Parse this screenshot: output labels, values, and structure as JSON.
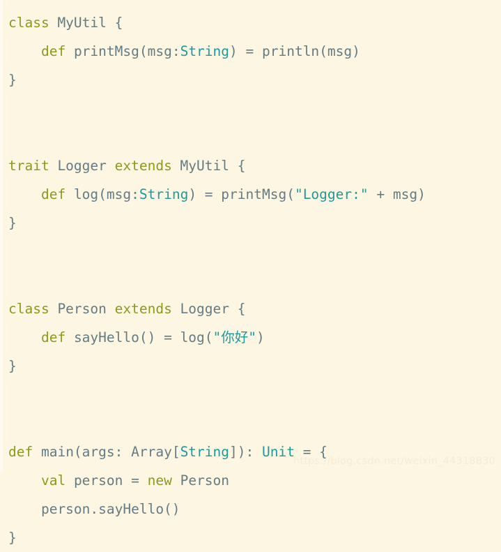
{
  "document": {
    "language": "Scala",
    "background_color": "#fdf6e3",
    "colors": {
      "background": "#fdf6e3",
      "default_text": "#657b83",
      "keyword": "#8a9a1e",
      "type": "#1f9a98",
      "string": "#1f9a98",
      "watermark": "#f6ecd6"
    },
    "watermark": "https://blog.csdn.net/weixin_44318830",
    "lines": [
      {
        "index": 1,
        "tokens": [
          {
            "text": "class",
            "kind": "keyword"
          },
          {
            "text": " MyUtil {",
            "kind": "plain"
          }
        ]
      },
      {
        "index": 2,
        "tokens": [
          {
            "text": "    ",
            "kind": "plain"
          },
          {
            "text": "def",
            "kind": "keyword"
          },
          {
            "text": " printMsg(msg:",
            "kind": "plain"
          },
          {
            "text": "String",
            "kind": "type"
          },
          {
            "text": ") = println(msg)",
            "kind": "plain"
          }
        ]
      },
      {
        "index": 3,
        "tokens": [
          {
            "text": "}",
            "kind": "plain"
          }
        ]
      },
      {
        "index": 4,
        "tokens": []
      },
      {
        "index": 5,
        "tokens": []
      },
      {
        "index": 6,
        "tokens": [
          {
            "text": "trait",
            "kind": "keyword"
          },
          {
            "text": " Logger ",
            "kind": "plain"
          },
          {
            "text": "extends",
            "kind": "keyword"
          },
          {
            "text": " MyUtil {",
            "kind": "plain"
          }
        ]
      },
      {
        "index": 7,
        "tokens": [
          {
            "text": "    ",
            "kind": "plain"
          },
          {
            "text": "def",
            "kind": "keyword"
          },
          {
            "text": " log(msg:",
            "kind": "plain"
          },
          {
            "text": "String",
            "kind": "type"
          },
          {
            "text": ") = printMsg(",
            "kind": "plain"
          },
          {
            "text": "\"Logger:\"",
            "kind": "string"
          },
          {
            "text": " + msg)",
            "kind": "plain"
          }
        ]
      },
      {
        "index": 8,
        "tokens": [
          {
            "text": "}",
            "kind": "plain"
          }
        ]
      },
      {
        "index": 9,
        "tokens": []
      },
      {
        "index": 10,
        "tokens": []
      },
      {
        "index": 11,
        "tokens": [
          {
            "text": "class",
            "kind": "keyword"
          },
          {
            "text": " Person ",
            "kind": "plain"
          },
          {
            "text": "extends",
            "kind": "keyword"
          },
          {
            "text": " Logger {",
            "kind": "plain"
          }
        ]
      },
      {
        "index": 12,
        "tokens": [
          {
            "text": "    ",
            "kind": "plain"
          },
          {
            "text": "def",
            "kind": "keyword"
          },
          {
            "text": " sayHello() = log(",
            "kind": "plain"
          },
          {
            "text": "\"你好\"",
            "kind": "string"
          },
          {
            "text": ")",
            "kind": "plain"
          }
        ]
      },
      {
        "index": 13,
        "tokens": [
          {
            "text": "}",
            "kind": "plain"
          }
        ]
      },
      {
        "index": 14,
        "tokens": []
      },
      {
        "index": 15,
        "tokens": []
      },
      {
        "index": 16,
        "tokens": [
          {
            "text": "def",
            "kind": "keyword"
          },
          {
            "text": " main(args: Array[",
            "kind": "plain"
          },
          {
            "text": "String",
            "kind": "type"
          },
          {
            "text": "]): ",
            "kind": "plain"
          },
          {
            "text": "Unit",
            "kind": "type"
          },
          {
            "text": " = {",
            "kind": "plain"
          }
        ]
      },
      {
        "index": 17,
        "tokens": [
          {
            "text": "    ",
            "kind": "plain"
          },
          {
            "text": "val",
            "kind": "keyword"
          },
          {
            "text": " person = ",
            "kind": "plain"
          },
          {
            "text": "new",
            "kind": "keyword"
          },
          {
            "text": " Person",
            "kind": "plain"
          }
        ]
      },
      {
        "index": 18,
        "tokens": [
          {
            "text": "    person.sayHello()",
            "kind": "plain"
          }
        ]
      },
      {
        "index": 19,
        "tokens": [
          {
            "text": "}",
            "kind": "plain"
          }
        ]
      }
    ]
  }
}
